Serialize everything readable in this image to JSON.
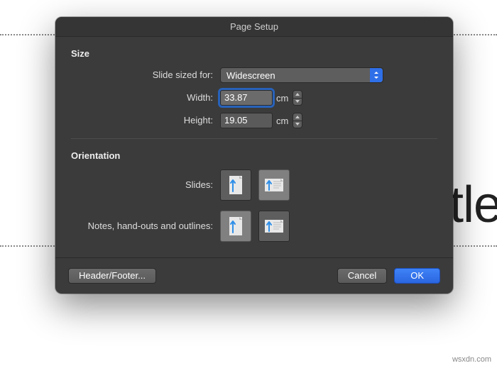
{
  "dialog": {
    "title": "Page Setup",
    "size": {
      "heading": "Size",
      "slide_sized_for_label": "Slide sized for:",
      "slide_sized_for_value": "Widescreen",
      "width_label": "Width:",
      "width_value": "33.87",
      "width_unit": "cm",
      "height_label": "Height:",
      "height_value": "19.05",
      "height_unit": "cm"
    },
    "orientation": {
      "heading": "Orientation",
      "slides_label": "Slides:",
      "slides_selected": "landscape",
      "notes_label": "Notes, hand-outs and outlines:",
      "notes_selected": "portrait"
    },
    "footer": {
      "header_footer_label": "Header/Footer...",
      "cancel_label": "Cancel",
      "ok_label": "OK"
    }
  },
  "background": {
    "partial_text": "tle"
  },
  "watermark": "wsxdn.com"
}
